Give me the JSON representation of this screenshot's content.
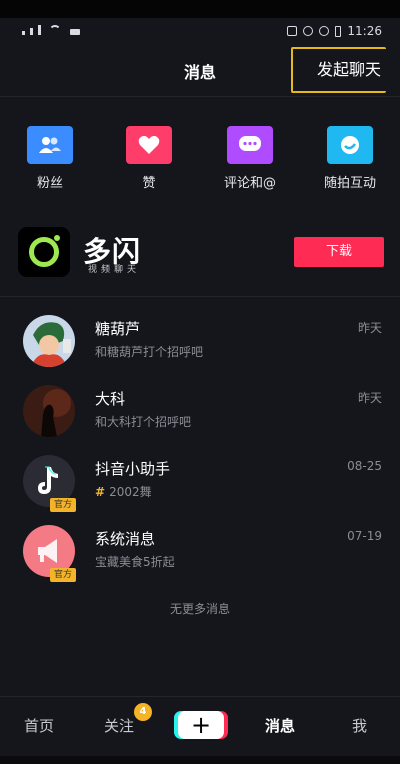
{
  "status_bar": {
    "time": "11:26"
  },
  "header": {
    "title": "消息",
    "start_chat_label": "发起聊天"
  },
  "quick_actions": [
    {
      "label": "粉丝",
      "icon": "fans-icon",
      "color": "#3b8cff"
    },
    {
      "label": "赞",
      "icon": "heart-icon",
      "color": "#fe3d6a"
    },
    {
      "label": "评论和@",
      "icon": "comment-icon",
      "color": "#b04cff"
    },
    {
      "label": "随拍互动",
      "icon": "camera-interact-icon",
      "color": "#20b8f0"
    }
  ],
  "promo": {
    "brand": "多闪",
    "subtitle": "视频聊天",
    "download_label": "下载"
  },
  "conversations": [
    {
      "name": "糖葫芦",
      "preview": "和糖葫芦打个招呼吧",
      "time": "昨天"
    },
    {
      "name": "大科",
      "preview": "和大科打个招呼吧",
      "time": "昨天"
    },
    {
      "name": "抖音小助手",
      "preview": "2002舞",
      "time": "08-25",
      "badge": "官方"
    },
    {
      "name": "系统消息",
      "preview": "宝藏美食5折起",
      "time": "07-19",
      "badge": "官方"
    }
  ],
  "footer_note": "无更多消息",
  "tabbar": {
    "home": "首页",
    "follow": "关注",
    "follow_count": "4",
    "plus": "+",
    "messages": "消息",
    "me": "我"
  }
}
